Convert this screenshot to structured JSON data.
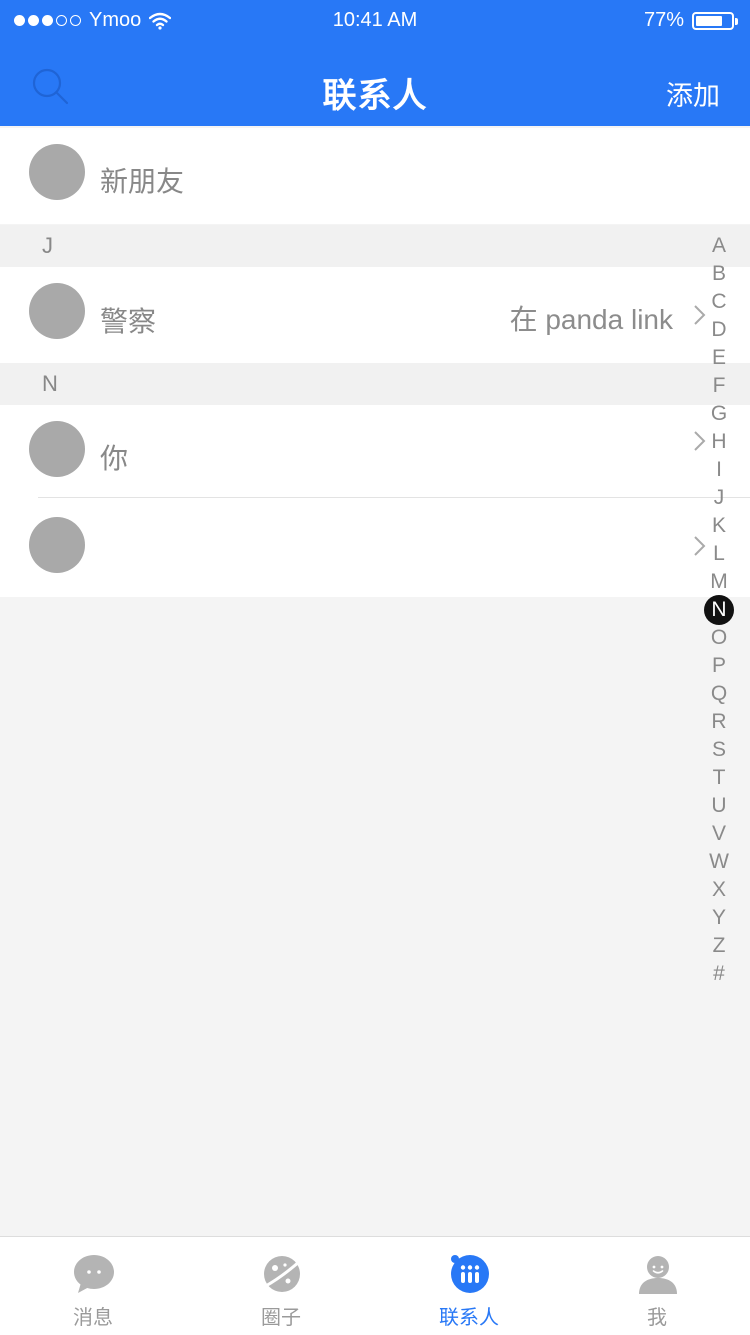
{
  "status": {
    "carrier": "Ymoo",
    "time": "10:41 AM",
    "battery": "77%",
    "battery_level": 0.77
  },
  "nav": {
    "title": "联系人",
    "add_label": "添加",
    "search_icon": "search-icon"
  },
  "new_friends": {
    "label": "新朋友"
  },
  "sections": [
    {
      "letter": "J",
      "items": [
        {
          "name": "警察",
          "subtitle": "在 panda link"
        }
      ]
    },
    {
      "letter": "N",
      "items": [
        {
          "name": "你",
          "subtitle": ""
        },
        {
          "name": "",
          "subtitle": ""
        }
      ]
    }
  ],
  "index_letters": [
    "A",
    "B",
    "C",
    "D",
    "E",
    "F",
    "G",
    "H",
    "I",
    "J",
    "K",
    "L",
    "M",
    "N",
    "O",
    "P",
    "Q",
    "R",
    "S",
    "T",
    "U",
    "V",
    "W",
    "X",
    "Y",
    "Z",
    "#"
  ],
  "index_active": "N",
  "tabs": [
    {
      "label": "消息",
      "icon": "chat-bubble-icon",
      "active": false
    },
    {
      "label": "圈子",
      "icon": "planet-icon",
      "active": false
    },
    {
      "label": "联系人",
      "icon": "contacts-icon",
      "active": true
    },
    {
      "label": "我",
      "icon": "person-icon",
      "active": false
    }
  ],
  "colors": {
    "primary": "#2878f6",
    "avatar_placeholder": "#a9a9a9",
    "tab_inactive": "#b4b4b4",
    "background": "#f4f4f4"
  }
}
